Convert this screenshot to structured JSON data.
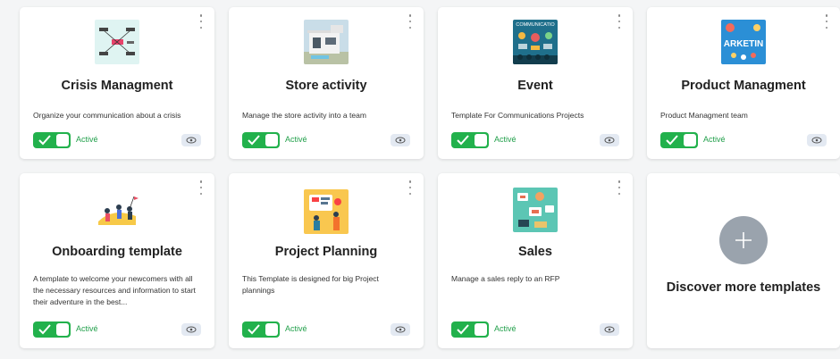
{
  "cards": [
    {
      "title": "Crisis Managment",
      "description": "Organize your communication about a crisis",
      "status": "Activé",
      "thumb_icon": "mindmap-icon"
    },
    {
      "title": "Store activity",
      "description": "Manage the store activity into a team",
      "status": "Activé",
      "thumb_icon": "store-building-icon"
    },
    {
      "title": "Event",
      "description": "Template For Communications Projects",
      "status": "Activé",
      "thumb_icon": "communication-event-icon",
      "thumb_text": "COMMUNICATIO"
    },
    {
      "title": "Product Managment",
      "description": "Product Managment team",
      "status": "Activé",
      "thumb_icon": "marketing-icon",
      "thumb_text": "ARKETIN"
    },
    {
      "title": "Onboarding template",
      "description": "A template to welcome your newcomers with all the necessary resources and information to start their adventure in the best...",
      "status": "Activé",
      "thumb_icon": "onboarding-team-icon"
    },
    {
      "title": "Project Planning",
      "description": "This Template is designed for big Project plannings",
      "status": "Activé",
      "thumb_icon": "project-planning-icon"
    },
    {
      "title": "Sales",
      "description": "Manage a sales reply to an RFP",
      "status": "Activé",
      "thumb_icon": "sales-icon"
    }
  ],
  "discover": {
    "title": "Discover more templates",
    "icon": "plus-icon"
  },
  "colors": {
    "toggle_on": "#22b14c",
    "status_text": "#22a04b",
    "plus_circle": "#9aa3ad",
    "eye_bg": "#e3e9f2"
  }
}
